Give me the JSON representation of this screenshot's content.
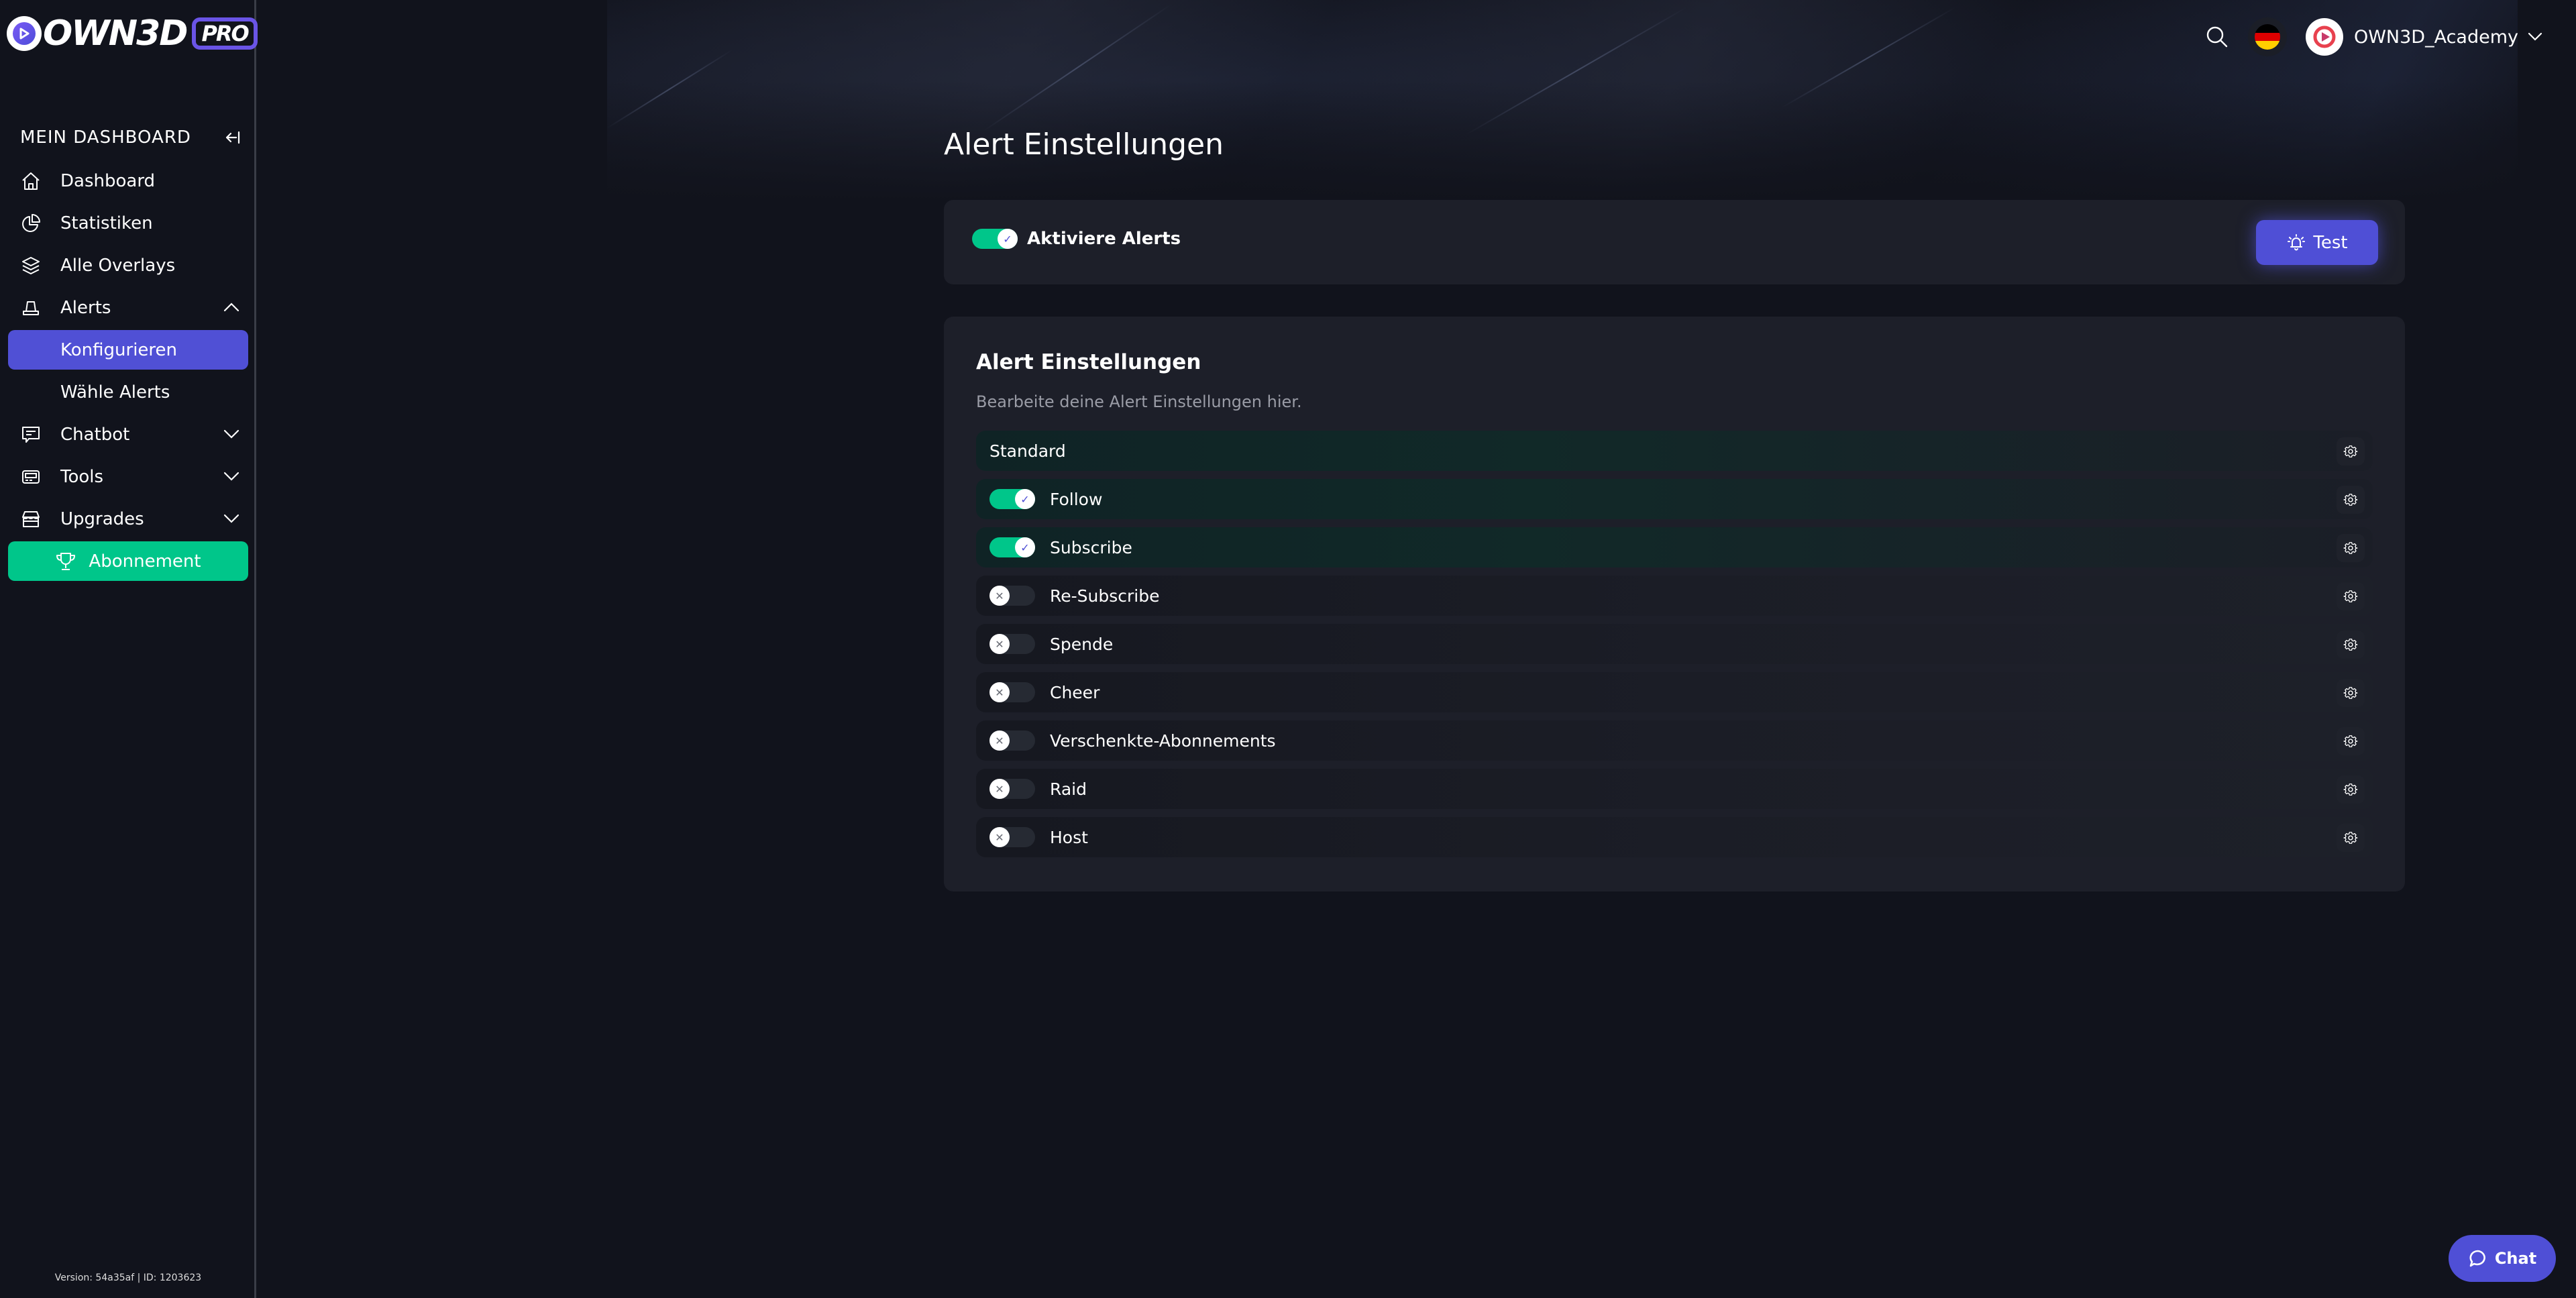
{
  "brand": {
    "logo_text": "OWN3D",
    "logo_badge": "PRO",
    "registered_mark": "R",
    "accent_color": "#5050d5",
    "success_color": "#00c68a"
  },
  "sidebar": {
    "section_title": "MEIN DASHBOARD",
    "collapse_icon": "collapse-left-icon",
    "items": [
      {
        "label": "Dashboard",
        "icon": "home-icon"
      },
      {
        "label": "Statistiken",
        "icon": "pie-chart-icon"
      },
      {
        "label": "Alle Overlays",
        "icon": "layers-icon"
      },
      {
        "label": "Alerts",
        "icon": "alert-light-icon",
        "expanded": true,
        "children": [
          {
            "label": "Konfigurieren",
            "active": true
          },
          {
            "label": "Wähle Alerts"
          }
        ]
      },
      {
        "label": "Chatbot",
        "icon": "chat-icon",
        "expanded": false
      },
      {
        "label": "Tools",
        "icon": "monitor-icon",
        "expanded": false
      },
      {
        "label": "Upgrades",
        "icon": "store-icon",
        "expanded": false
      },
      {
        "label": "Abonnement",
        "icon": "trophy-icon",
        "cta": true
      }
    ],
    "version_text": "Version: 54a35af | ID: 1203623"
  },
  "topbar": {
    "search_icon": "search-icon",
    "language": "de",
    "user_name": "OWN3D_Academy"
  },
  "page": {
    "title": "Alert Einstellungen",
    "activate": {
      "label": "Aktiviere Alerts",
      "enabled": true
    },
    "test_button": "Test",
    "settings": {
      "title": "Alert Einstellungen",
      "subtitle": "Bearbeite deine Alert Einstellungen hier.",
      "alerts": [
        {
          "name": "Standard",
          "has_toggle": false
        },
        {
          "name": "Follow",
          "has_toggle": true,
          "enabled": true
        },
        {
          "name": "Subscribe",
          "has_toggle": true,
          "enabled": true
        },
        {
          "name": "Re-Subscribe",
          "has_toggle": true,
          "enabled": false
        },
        {
          "name": "Spende",
          "has_toggle": true,
          "enabled": false
        },
        {
          "name": "Cheer",
          "has_toggle": true,
          "enabled": false
        },
        {
          "name": "Verschenkte-Abonnements",
          "has_toggle": true,
          "enabled": false
        },
        {
          "name": "Raid",
          "has_toggle": true,
          "enabled": false
        },
        {
          "name": "Host",
          "has_toggle": true,
          "enabled": false
        }
      ]
    }
  },
  "chat_widget": {
    "label": "Chat"
  },
  "glyphs": {
    "check": "✓",
    "cross": "✕"
  }
}
